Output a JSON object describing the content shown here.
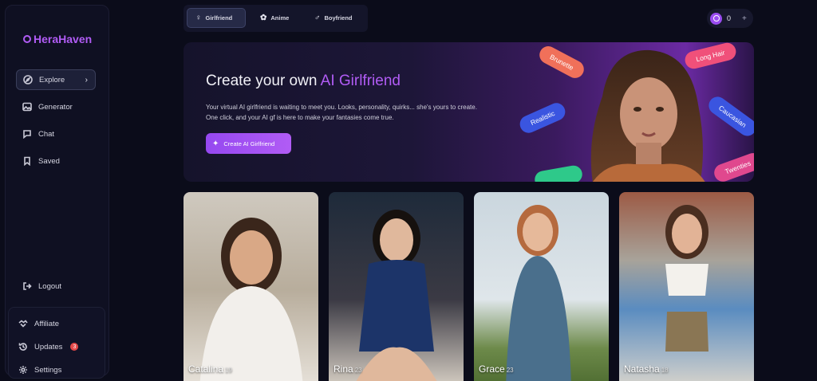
{
  "brand": {
    "name": "HeraHaven",
    "color": "#b15cf5"
  },
  "sidebar": {
    "items": [
      {
        "label": "Explore",
        "icon": "compass-icon",
        "active": true
      },
      {
        "label": "Generator",
        "icon": "image-icon"
      },
      {
        "label": "Chat",
        "icon": "chat-icon"
      },
      {
        "label": "Saved",
        "icon": "bookmark-icon"
      }
    ],
    "logout": "Logout",
    "bottom": [
      {
        "label": "Affiliate",
        "icon": "handshake-icon"
      },
      {
        "label": "Updates",
        "icon": "history-icon",
        "badge": "3"
      },
      {
        "label": "Settings",
        "icon": "gear-icon"
      }
    ]
  },
  "tabs": [
    {
      "label": "Girlfriend",
      "icon": "female-icon",
      "active": true
    },
    {
      "label": "Anime",
      "icon": "swirl-icon"
    },
    {
      "label": "Boyfriend",
      "icon": "male-icon"
    }
  ],
  "coins": {
    "count": "0",
    "add": "+"
  },
  "hero": {
    "title_prefix": "Create your own ",
    "title_accent": "AI Girlfriend",
    "description": "Your virtual AI girlfriend is waiting to meet you. Looks, personality, quirks... she's yours to create. One click, and your AI gf is here to make your fantasies come true.",
    "button_label": "Create AI Girlfriend",
    "pills": [
      "Brunette",
      "Long Hair",
      "Realistic",
      "Caucasian",
      "Twenties"
    ]
  },
  "cards": [
    {
      "name": "Catalina",
      "age": "19"
    },
    {
      "name": "Rina",
      "age": "23"
    },
    {
      "name": "Grace",
      "age": "23"
    },
    {
      "name": "Natasha",
      "age": "18"
    }
  ]
}
